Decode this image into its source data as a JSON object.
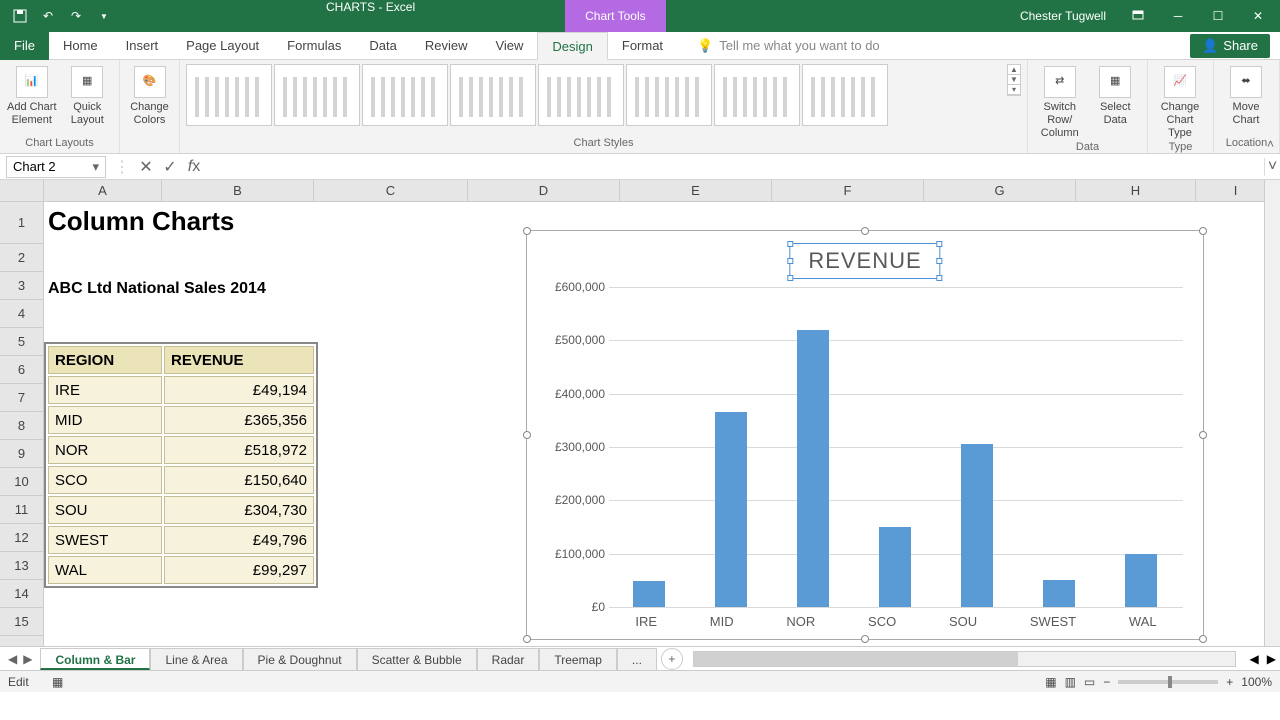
{
  "titlebar": {
    "doc_title": "CHARTS - Excel",
    "chart_tools": "Chart Tools",
    "username": "Chester Tugwell"
  },
  "ribbon_tabs": [
    "File",
    "Home",
    "Insert",
    "Page Layout",
    "Formulas",
    "Data",
    "Review",
    "View",
    "Design",
    "Format"
  ],
  "tell_me": "Tell me what you want to do",
  "share": "Share",
  "ribbon": {
    "add_chart_element": "Add Chart Element",
    "quick_layout": "Quick Layout",
    "change_colors": "Change Colors",
    "chart_layouts_label": "Chart Layouts",
    "chart_styles_label": "Chart Styles",
    "switch_row_col": "Switch Row/ Column",
    "select_data": "Select Data",
    "data_label": "Data",
    "change_chart_type": "Change Chart Type",
    "type_label": "Type",
    "move_chart": "Move Chart",
    "location_label": "Location"
  },
  "namebox": "Chart 2",
  "formula": "",
  "columns": [
    "A",
    "B",
    "C",
    "D",
    "E",
    "F",
    "G",
    "H",
    "I"
  ],
  "rows": [
    "1",
    "2",
    "3",
    "4",
    "5",
    "6",
    "7",
    "8",
    "9",
    "10",
    "11",
    "12",
    "13",
    "14",
    "15"
  ],
  "sheet_title": "Column  Charts",
  "sheet_subtitle": "ABC Ltd National Sales 2014",
  "table": {
    "headers": [
      "REGION",
      "REVENUE"
    ],
    "rows": [
      {
        "region": "IRE",
        "revenue": "£49,194"
      },
      {
        "region": "MID",
        "revenue": "£365,356"
      },
      {
        "region": "NOR",
        "revenue": "£518,972"
      },
      {
        "region": "SCO",
        "revenue": "£150,640"
      },
      {
        "region": "SOU",
        "revenue": "£304,730"
      },
      {
        "region": "SWEST",
        "revenue": "£49,796"
      },
      {
        "region": "WAL",
        "revenue": "£99,297"
      }
    ]
  },
  "chart_title": "REVENUE",
  "y_ticks": [
    "£0",
    "£100,000",
    "£200,000",
    "£300,000",
    "£400,000",
    "£500,000",
    "£600,000"
  ],
  "x_labels": [
    "IRE",
    "MID",
    "NOR",
    "SCO",
    "SOU",
    "SWEST",
    "WAL"
  ],
  "sheet_tabs": [
    "Column & Bar",
    "Line & Area",
    "Pie & Doughnut",
    "Scatter & Bubble",
    "Radar",
    "Treemap",
    "..."
  ],
  "status_mode": "Edit",
  "zoom": "100%",
  "chart_data": {
    "type": "bar",
    "title": "REVENUE",
    "xlabel": "",
    "ylabel": "",
    "ylim": [
      0,
      600000
    ],
    "categories": [
      "IRE",
      "MID",
      "NOR",
      "SCO",
      "SOU",
      "SWEST",
      "WAL"
    ],
    "values": [
      49194,
      365356,
      518972,
      150640,
      304730,
      49796,
      99297
    ]
  }
}
